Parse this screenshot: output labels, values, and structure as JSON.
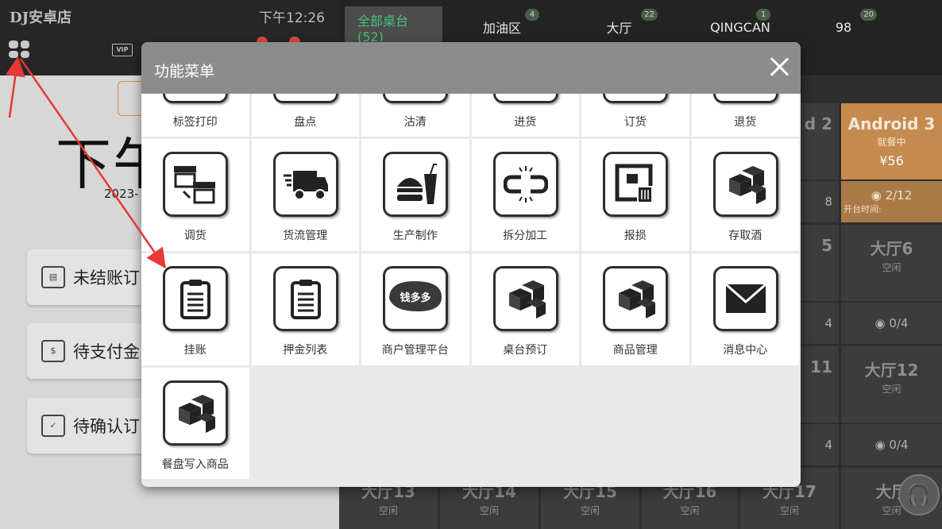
{
  "header": {
    "store_name": "DJ安卓店",
    "time": "下午12:26",
    "tabs": [
      {
        "label": "全部桌台(52)",
        "badge": ""
      },
      {
        "label": "加油区",
        "badge": "4"
      },
      {
        "label": "大厅",
        "badge": "22"
      },
      {
        "label": "QINGCAN",
        "badge": "1"
      },
      {
        "label": "98",
        "badge": "20"
      }
    ],
    "vip_label": "VIP"
  },
  "left_panel": {
    "big_time": "下午",
    "date": "2023-",
    "cards": [
      {
        "label": "未结账订"
      },
      {
        "label": "待支付金"
      },
      {
        "label": "待确认订"
      }
    ]
  },
  "tables": {
    "col_header_partial": "d 2",
    "android3": {
      "name": "Android 3",
      "status": "就餐中",
      "price": "¥56",
      "seats": "2/12",
      "open_label": "开台时间:"
    },
    "partial_8": "8",
    "partial_5": "5",
    "hall6": {
      "name": "大厅6",
      "status": "空闲",
      "seats": "0/4"
    },
    "partial_4a": "4",
    "partial_11": "11",
    "hall12": {
      "name": "大厅12",
      "status": "空闲",
      "seats": "0/4"
    },
    "partial_4b": "4",
    "bottom": [
      {
        "name": "大厅13",
        "status": "空闲"
      },
      {
        "name": "大厅14",
        "status": "空闲"
      },
      {
        "name": "大厅15",
        "status": "空闲"
      },
      {
        "name": "大厅16",
        "status": "空闲"
      },
      {
        "name": "大厅17",
        "status": "空闲"
      },
      {
        "name": "大厅",
        "status": "空闲"
      }
    ]
  },
  "modal": {
    "title": "功能菜单",
    "row1": [
      "标签打印",
      "盘点",
      "沽清",
      "进货",
      "订货",
      "退货"
    ],
    "row2": [
      "调货",
      "货流管理",
      "生产制作",
      "拆分加工",
      "报损",
      "存取酒"
    ],
    "row3": [
      "挂账",
      "押金列表",
      "商户管理平台",
      "桌台预订",
      "商品管理",
      "消息中心"
    ],
    "row4": [
      "餐盘写入商品"
    ],
    "qdd_logo": "钱多多"
  },
  "colors": {
    "accent_green": "#46c37b",
    "busy_orange": "#c58a4e",
    "arrow_red": "#e53935"
  }
}
